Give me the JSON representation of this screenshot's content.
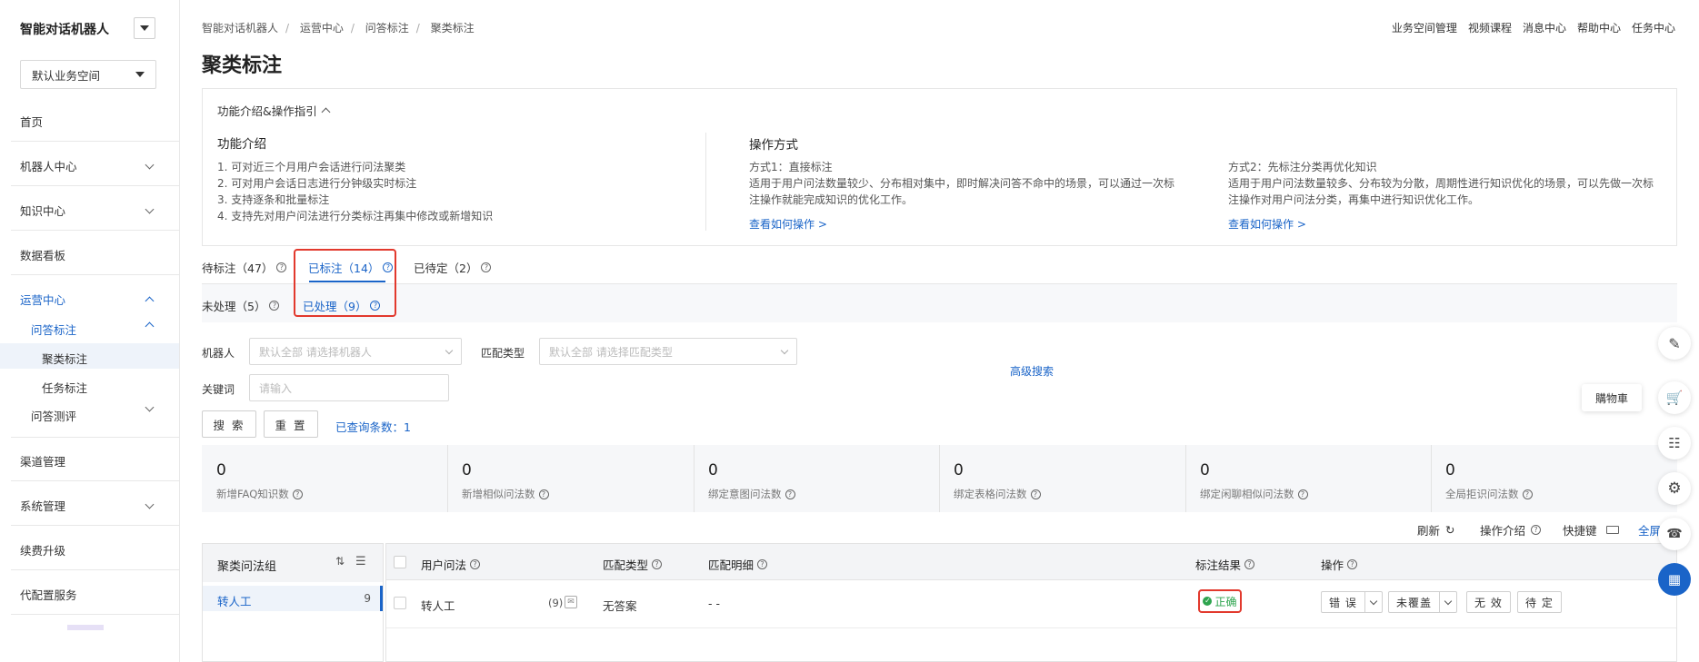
{
  "sidebar": {
    "brand": "智能对话机器人",
    "workspace": "默认业务空间",
    "items": {
      "home": "首页",
      "bot_center": "机器人中心",
      "knowledge": "知识中心",
      "dashboard": "数据看板",
      "ops_center": "运营中心",
      "qa_annotation": "问答标注",
      "cluster_annotation": "聚类标注",
      "task_annotation": "任务标注",
      "qa_eval": "问答测评",
      "channel": "渠道管理",
      "system": "系统管理",
      "renew": "续费升级",
      "config_service": "代配置服务"
    }
  },
  "breadcrumb": [
    "智能对话机器人",
    "运营中心",
    "问答标注",
    "聚类标注"
  ],
  "top_links": [
    "业务空间管理",
    "视频课程",
    "消息中心",
    "帮助中心",
    "任务中心"
  ],
  "page_title": "聚类标注",
  "guide": {
    "toggle": "功能介绍&操作指引",
    "intro_title": "功能介绍",
    "intro_lines": [
      "1. 可对近三个月用户会话进行问法聚类",
      "2. 可对用户会话日志进行分钟级实时标注",
      "3. 支持逐条和批量标注",
      "4. 支持先对用户问法进行分类标注再集中修改或新增知识"
    ],
    "ops_title": "操作方式",
    "m1_title": "方式1：直接标注",
    "m1_lines": [
      "适用于用户问法数量较少、分布相对集中，即时解决问答不命中的场景，可以通过一次标",
      "注操作就能完成知识的优化工作。"
    ],
    "m1_link": "查看如何操作 >",
    "m2_title": "方式2：先标注分类再优化知识",
    "m2_lines": [
      "适用于用户问法数量较多、分布较为分散，周期性进行知识优化的场景，可以先做一次标",
      "注操作对用户问法分类，再集中进行知识优化工作。"
    ],
    "m2_link": "查看如何操作 >"
  },
  "tabs": {
    "pending": "待标注（47）",
    "labeled": "已标注（14）",
    "undetermined": "已待定（2）"
  },
  "subtabs": {
    "unprocessed": "未处理（5）",
    "processed": "已处理（9）"
  },
  "filters": {
    "bot_label": "机器人",
    "bot_placeholder": "默认全部 请选择机器人",
    "match_label": "匹配类型",
    "match_placeholder": "默认全部 请选择匹配类型",
    "keyword_label": "关键词",
    "keyword_placeholder": "请输入",
    "advanced": "高级搜索",
    "search_btn": "搜 索",
    "reset_btn": "重 置",
    "count_text": "已查询条数：1"
  },
  "stats": [
    {
      "value": "0",
      "label": "新增FAQ知识数"
    },
    {
      "value": "0",
      "label": "新增相似问法数"
    },
    {
      "value": "0",
      "label": "绑定意图问法数"
    },
    {
      "value": "0",
      "label": "绑定表格问法数"
    },
    {
      "value": "0",
      "label": "绑定闲聊相似问法数"
    },
    {
      "value": "0",
      "label": "全局拒识问法数"
    }
  ],
  "toolbar": {
    "refresh": "刷新",
    "op_intro": "操作介绍",
    "shortcut": "快捷键",
    "fullscreen": "全屏"
  },
  "cluster": {
    "title": "聚类问法组",
    "rows": [
      {
        "name": "转人工",
        "count": "9"
      }
    ]
  },
  "table": {
    "headers": {
      "user_query": "用户问法",
      "match_type": "匹配类型",
      "match_detail": "匹配明细",
      "result": "标注结果",
      "ops": "操作"
    },
    "row": {
      "user_query": "转人工",
      "query_count": "(9)",
      "match_type": "无答案",
      "match_detail": "- -",
      "result": "正确",
      "btn_wrong": "错 误",
      "btn_uncovered": "未覆盖",
      "btn_invalid": "无 效",
      "btn_pending": "待 定"
    }
  },
  "float_tooltip": "購物車",
  "colors": {
    "accent": "#1a64c8",
    "highlight": "#e2392d",
    "success": "#2da44e"
  }
}
